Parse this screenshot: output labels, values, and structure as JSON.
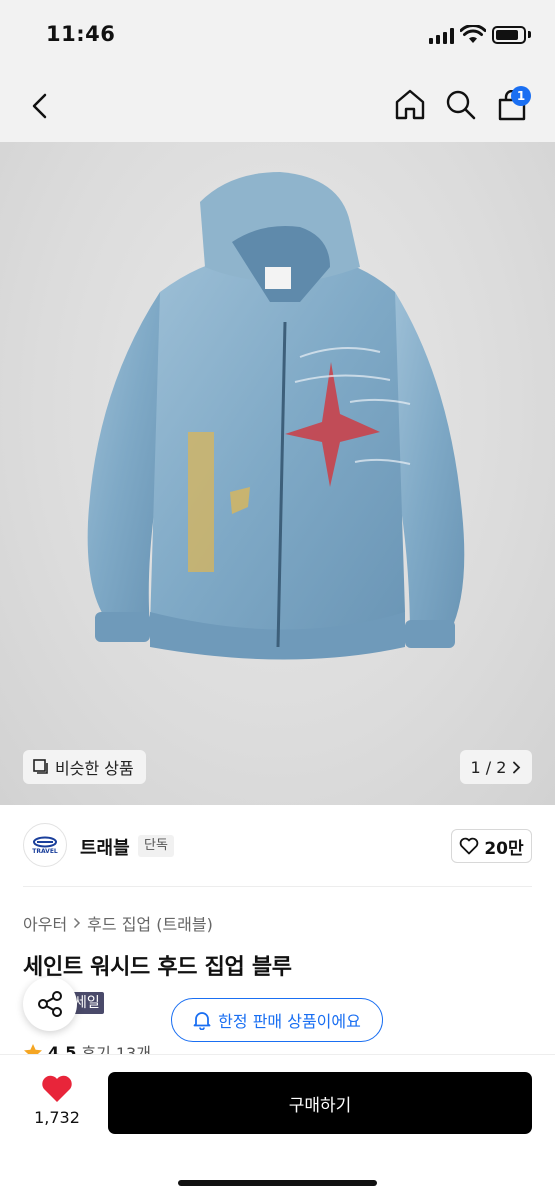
{
  "status_bar": {
    "time": "11:46"
  },
  "nav": {
    "cart_count": "1"
  },
  "image": {
    "similar_label": "비슷한 상품",
    "pager": "1 / 2"
  },
  "brand": {
    "name": "트래블",
    "badge": "단독",
    "logo_text": "TRAVEL",
    "likes": "20만"
  },
  "product": {
    "breadcrumb": [
      "아우터",
      "후드 집업 (트래블)"
    ],
    "title": "세인트 워시드 후드 집업 블루",
    "sale_tag": "세일",
    "limited_label": "한정 판매 상품이에요",
    "rating": "4.5",
    "reviews": "후기 13개"
  },
  "bottom": {
    "wish_count": "1,732",
    "buy_label": "구매하기"
  },
  "colors": {
    "accent": "#1a6ff2",
    "heart": "#e8253a",
    "hoodie": "#7fa9c6",
    "star": "#f5a623"
  },
  "icons": [
    "back-icon",
    "home-icon",
    "search-icon",
    "cart-icon",
    "similar-icon",
    "chevron-right-icon",
    "heart-outline-icon",
    "share-icon",
    "bell-icon",
    "star-icon",
    "heart-filled-icon"
  ]
}
